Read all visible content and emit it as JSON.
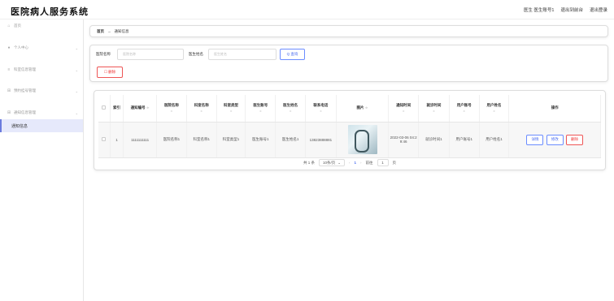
{
  "app": {
    "title": "医院病人服务系统"
  },
  "header": {
    "user": "医生 医生账号1",
    "to_frontend": "退出到前台",
    "logout": "退出登录"
  },
  "sidebar": {
    "items": [
      {
        "label": "首页",
        "icon": "home-icon"
      },
      {
        "label": "个人中心",
        "icon": "user-icon"
      },
      {
        "label": "科室信息管理",
        "icon": "menu-icon"
      },
      {
        "label": "预约挂号管理",
        "icon": "grid-icon"
      },
      {
        "label": "通知信息管理",
        "icon": "grid-icon"
      }
    ],
    "active_sub": "通知信息"
  },
  "breadcrumb": {
    "home": "首页",
    "sep": "→",
    "current": "通知信息"
  },
  "search": {
    "hospital_label": "医院名称",
    "hospital_placeholder": "医院名称",
    "doctor_label": "医生姓名",
    "doctor_placeholder": "医生姓名",
    "query_button": "Q 查询",
    "delete_button": "☐ 删除"
  },
  "table": {
    "headers": [
      "索引",
      "通知编号",
      "医院名称",
      "科室名称",
      "科室类型",
      "医生账号",
      "医生姓名",
      "联系电话",
      "图片",
      "通知时间",
      "就诊时间",
      "用户账号",
      "用户姓名",
      "操作"
    ],
    "sort_mark": "≑",
    "rows": [
      {
        "index": "1",
        "notice_no": "1111111111",
        "hospital": "医院名称1",
        "dept_name": "科室名称1",
        "dept_type": "科室类型1",
        "doctor_account": "医生账号1",
        "doctor_name": "医生姓名1",
        "phone": "13823888881",
        "notice_time": "2022-03-06 04:29:46",
        "visit_time": "就诊时间1",
        "user_account": "用户账号1",
        "user_name": "用户姓名1",
        "actions": {
          "detail": "详情",
          "edit": "修改",
          "delete": "删除"
        }
      }
    ]
  },
  "pagination": {
    "total": "共 1 条",
    "page_size": "10条/页",
    "prev": "‹",
    "current": "1",
    "next": "›",
    "goto_label": "前往",
    "goto_value": "1",
    "goto_suffix": "页"
  },
  "colors": {
    "accent": "#4a6cf0",
    "danger": "#e33",
    "active_bg": "#e6e9fb"
  }
}
